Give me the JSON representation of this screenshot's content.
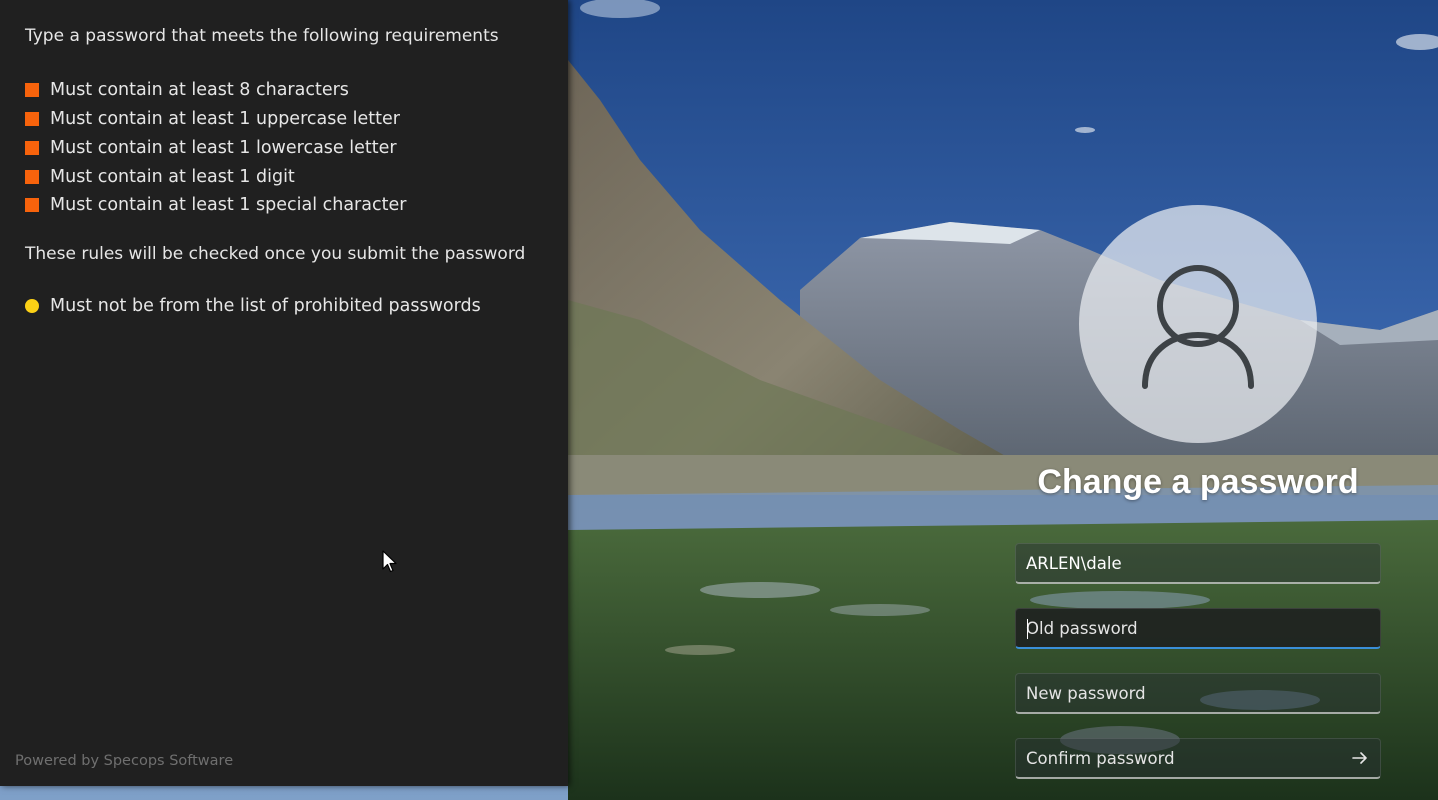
{
  "panel": {
    "heading": "Type a password that meets the following requirements",
    "requirements": [
      {
        "label": "Must contain at least 8 characters",
        "status_color": "#f7630c"
      },
      {
        "label": "Must contain at least 1 uppercase letter",
        "status_color": "#f7630c"
      },
      {
        "label": "Must contain at least 1 lowercase letter",
        "status_color": "#f7630c"
      },
      {
        "label": "Must contain at least 1 digit",
        "status_color": "#f7630c"
      },
      {
        "label": "Must contain at least 1 special character",
        "status_color": "#f7630c"
      }
    ],
    "subheading": "These rules will be checked once you submit the password",
    "submit_rules": [
      {
        "label": "Must not be from the list of prohibited passwords",
        "status_color": "#fcd116"
      }
    ],
    "footer": "Powered by Specops Software"
  },
  "login": {
    "avatar_icon": "user-icon",
    "title": "Change a password",
    "username": {
      "value": "ARLEN\\dale",
      "placeholder": ""
    },
    "old_password": {
      "value": "",
      "placeholder": "Old password",
      "focused": true
    },
    "new_password": {
      "value": "",
      "placeholder": "New password"
    },
    "confirm_password": {
      "value": "",
      "placeholder": "Confirm password"
    },
    "submit_icon": "arrow-right-icon"
  },
  "colors": {
    "accent_focus": "#3a8fd8",
    "panel_bg": "#202020",
    "requirement_unmet": "#f7630c",
    "rule_pending": "#fcd116"
  }
}
